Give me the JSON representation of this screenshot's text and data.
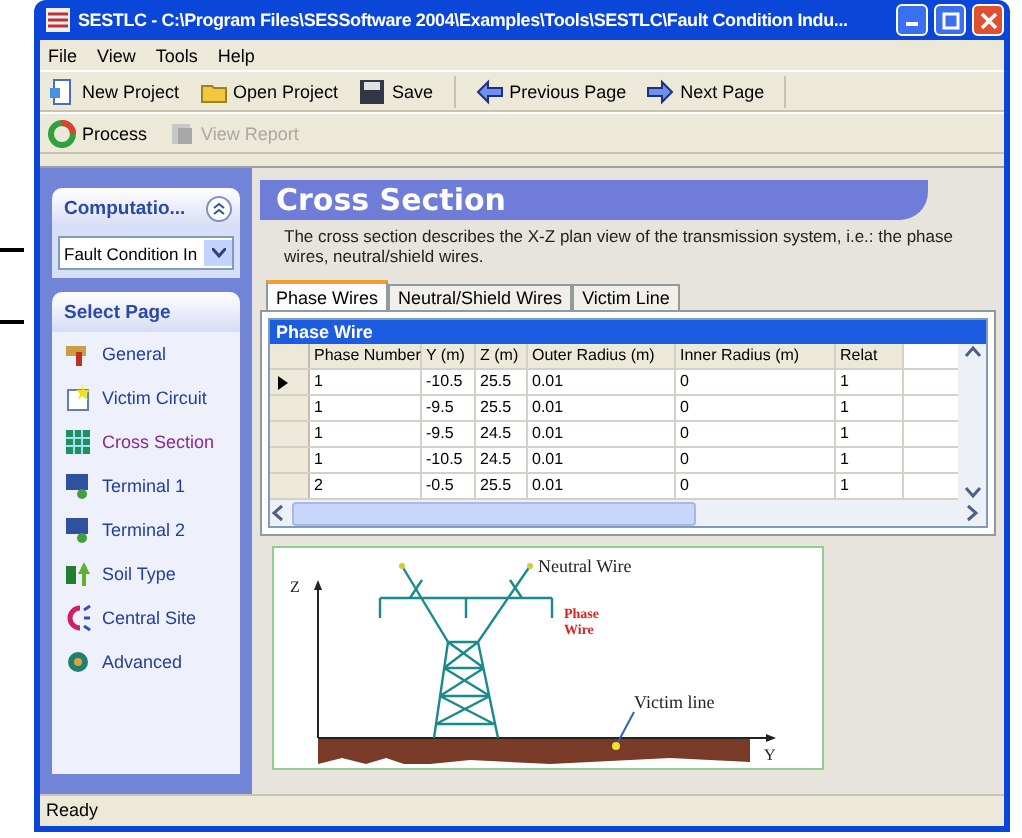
{
  "window": {
    "title": "SESTLC - C:\\Program Files\\SESSoftware 2004\\Examples\\Tools\\SESTLC\\Fault Condition Indu..."
  },
  "menu": [
    "File",
    "View",
    "Tools",
    "Help"
  ],
  "toolbar": [
    {
      "label": "New Project",
      "disabled": false
    },
    {
      "label": "Open Project",
      "disabled": false
    },
    {
      "label": "Save",
      "disabled": false
    },
    {
      "label": "Previous Page",
      "disabled": false
    },
    {
      "label": "Next Page",
      "disabled": false
    }
  ],
  "toolbar2": [
    {
      "label": "Process",
      "disabled": false
    },
    {
      "label": "View Report",
      "disabled": true
    }
  ],
  "sidebar": {
    "computation": {
      "title": "Computatio...",
      "value": "Fault Condition In"
    },
    "select_page": {
      "title": "Select Page",
      "items": [
        {
          "label": "General",
          "selected": false
        },
        {
          "label": "Victim Circuit",
          "selected": false
        },
        {
          "label": "Cross Section",
          "selected": true
        },
        {
          "label": "Terminal 1",
          "selected": false
        },
        {
          "label": "Terminal 2",
          "selected": false
        },
        {
          "label": "Soil Type",
          "selected": false
        },
        {
          "label": "Central Site",
          "selected": false
        },
        {
          "label": "Advanced",
          "selected": false
        }
      ]
    }
  },
  "header": {
    "title": "Cross Section",
    "description": "The cross section describes the X-Z plan view of the transmission system, i.e.: the phase wires, neutral/shield wires."
  },
  "tabs": [
    {
      "label": "Phase Wires",
      "selected": true
    },
    {
      "label": "Neutral/Shield Wires",
      "selected": false
    },
    {
      "label": "Victim Line",
      "selected": false
    }
  ],
  "grid": {
    "title": "Phase Wire",
    "columns": [
      "Phase Number",
      "Y  (m)",
      "Z  (m)",
      "Outer Radius  (m)",
      "Inner Radius  (m)",
      "Relat"
    ],
    "rows": [
      {
        "current": true,
        "cells": [
          "1",
          "-10.5",
          "25.5",
          "0.01",
          "0",
          "1"
        ]
      },
      {
        "current": false,
        "cells": [
          "1",
          "-9.5",
          "25.5",
          "0.01",
          "0",
          "1"
        ]
      },
      {
        "current": false,
        "cells": [
          "1",
          "-9.5",
          "24.5",
          "0.01",
          "0",
          "1"
        ]
      },
      {
        "current": false,
        "cells": [
          "1",
          "-10.5",
          "24.5",
          "0.01",
          "0",
          "1"
        ]
      },
      {
        "current": false,
        "cells": [
          "2",
          "-0.5",
          "25.5",
          "0.01",
          "0",
          "1"
        ]
      }
    ]
  },
  "diagram": {
    "z_axis": "Z",
    "y_axis": "Y",
    "neutral_wire": "Neutral Wire",
    "phase_wire": [
      "Phase",
      "Wire"
    ],
    "victim_line": "Victim line"
  },
  "status_bar": "Ready"
}
